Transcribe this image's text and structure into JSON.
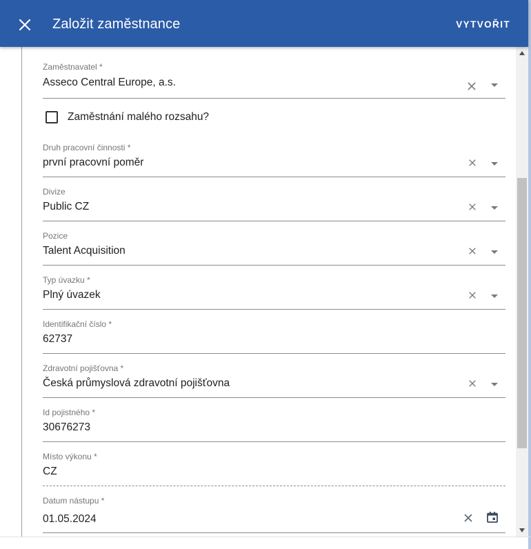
{
  "header": {
    "title": "Založit zaměstnance",
    "create_label": "VYTVOŘIT",
    "close_icon": "close-icon",
    "color": "#2b5ca8"
  },
  "form": {
    "employer": {
      "label": "Zaměstnavatel *",
      "value": "Asseco Central Europe, a.s."
    },
    "small_employment": {
      "label": "Zaměstnání malého rozsahu?",
      "checked": false
    },
    "activity_type": {
      "label": "Druh pracovní činnosti *",
      "value": "první pracovní poměr"
    },
    "division": {
      "label": "Divize",
      "value": "Public CZ"
    },
    "position": {
      "label": "Pozice",
      "value": "Talent Acquisition"
    },
    "workload_type": {
      "label": "Typ úvazku *",
      "value": "Plný úvazek"
    },
    "id_number": {
      "label": "Identifikační číslo *",
      "value": "62737"
    },
    "health_insurer": {
      "label": "Zdravotní pojišťovna *",
      "value": "Česká průmyslová zdravotní pojišťovna"
    },
    "insured_id": {
      "label": "Id pojistného *",
      "value": "30676273"
    },
    "workplace": {
      "label": "Místo výkonu *",
      "value": "CZ"
    },
    "start_date": {
      "label": "Datum nástupu *",
      "value": "01.05.2024"
    }
  }
}
